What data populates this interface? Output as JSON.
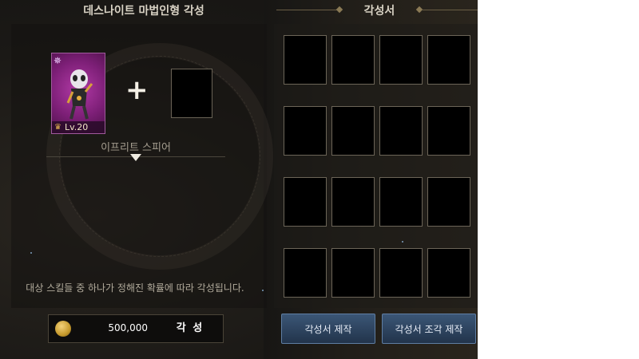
{
  "left_panel": {
    "title": "데스나이트 마법인형 각성",
    "doll": {
      "level": "Lv.20",
      "name": "이프리트 스피어",
      "badge_icon": "rank-badge-icon"
    },
    "hint": "대상 스킬들 중 하나가 정해진 확률에 따라 각성됩니다.",
    "cost": "500,000",
    "awaken_label": "각 성"
  },
  "right_panel": {
    "title": "각성서",
    "slots": 16,
    "craft_book_label": "각성서 제작",
    "craft_fragment_label": "각성서 조각 제작"
  },
  "colors": {
    "doll_card": "#7d1f77",
    "button": "#2c4260",
    "coin": "#d4a83a"
  }
}
